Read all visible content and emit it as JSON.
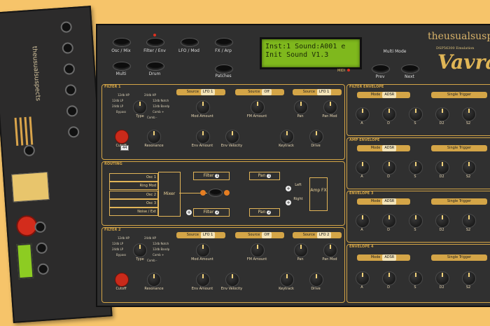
{
  "app": {
    "brand": "theusualsuspects",
    "product": "Vavra",
    "sublabel": "DSP56300 Emulation"
  },
  "rack": {
    "brand": "theusualsuspects"
  },
  "header": {
    "buttons": [
      {
        "label": "Osc / Mix"
      },
      {
        "label": "Filter / Env"
      },
      {
        "label": "LFO / Mod"
      },
      {
        "label": "FX / Arp"
      },
      {
        "label": "Multi"
      },
      {
        "label": "Drum"
      },
      {
        "label": "Patches"
      }
    ],
    "multimode_label": "Multi Mode",
    "prev_label": "Prev",
    "next_label": "Next",
    "midi_label": "MIDI"
  },
  "lcd": {
    "line1": "Inst:1  Sound:A001 e",
    "line2": "Init Sound V1.3"
  },
  "filter1": {
    "title": "FILTER 1",
    "type_options": [
      "12db HP",
      "24db HP",
      "12db LP",
      "24db LP",
      "Bypass",
      "12db Notch",
      "12db Notch",
      "12db Bandp",
      "Comb +",
      "Comb -"
    ],
    "type_label": "Type",
    "cutoff_label": "Cutoff",
    "cutoff_value": "44",
    "resonance_label": "Resonance",
    "mod_amount_label": "Mod Amount",
    "fm_amount_label": "FM Amount",
    "pan_label": "Pan",
    "panmod_label": "Pan Mod",
    "envamount_label": "Env Amount",
    "envvelocity_label": "Env Velocity",
    "keytrack_label": "Keytrack",
    "drive_label": "Drive",
    "source_label": "Source",
    "source1_value": "LFO 1",
    "source2_value": "Off",
    "source3_value": "LFO 1"
  },
  "routing": {
    "title": "ROUTING",
    "inputs": [
      "Osc 1",
      "Ring Mod",
      "Osc 2",
      "Osc 3",
      "Noise / Ext"
    ],
    "mixer": "Mixer",
    "filter1": "Filter",
    "filter2": "Filter",
    "pan1": "Pan",
    "pan2": "Pan",
    "left": "Left",
    "right": "Right",
    "amp": "Amp FX",
    "num1": "1",
    "num2": "2"
  },
  "filter2": {
    "title": "FILTER 2",
    "type_label": "Type",
    "cutoff_label": "Cutoff",
    "resonance_label": "Resonance",
    "mod_amount_label": "Mod Amount",
    "fm_amount_label": "FM Amount",
    "pan_label": "Pan",
    "panmod_label": "Pan Mod",
    "envamount_label": "Env Amount",
    "envvelocity_label": "Env Velocity",
    "keytrack_label": "Keytrack",
    "drive_label": "Drive",
    "source_label": "Source",
    "source1_value": "LFO 1",
    "source2_value": "Off",
    "source3_value": "LFO 2"
  },
  "envelopes": [
    {
      "title": "FILTER ENVELOPE",
      "mode_label": "Mode",
      "mode_value": "ADSR",
      "trigger_label": "Single Trigger",
      "knobs": [
        "A",
        "D",
        "S",
        "D2",
        "S2"
      ]
    },
    {
      "title": "AMP ENVELOPE",
      "mode_label": "Mode",
      "mode_value": "ADSR",
      "trigger_label": "Single Trigger",
      "knobs": [
        "A",
        "D",
        "S",
        "D2",
        "S2"
      ]
    },
    {
      "title": "ENVELOPE 3",
      "mode_label": "Mode",
      "mode_value": "ADSR",
      "trigger_label": "Single Trigger",
      "knobs": [
        "A",
        "D",
        "S",
        "D2",
        "S2"
      ]
    },
    {
      "title": "ENVELOPE 4",
      "mode_label": "Mode",
      "mode_value": "ADSR",
      "trigger_label": "Single Trigger",
      "knobs": [
        "A",
        "D",
        "S",
        "D2",
        "S2"
      ]
    }
  ],
  "colors": {
    "background": "#f6c46a",
    "panel": "#2f2f2f",
    "accent": "#d4a547",
    "lcd": "#7fb81d",
    "led": "#e03020"
  }
}
